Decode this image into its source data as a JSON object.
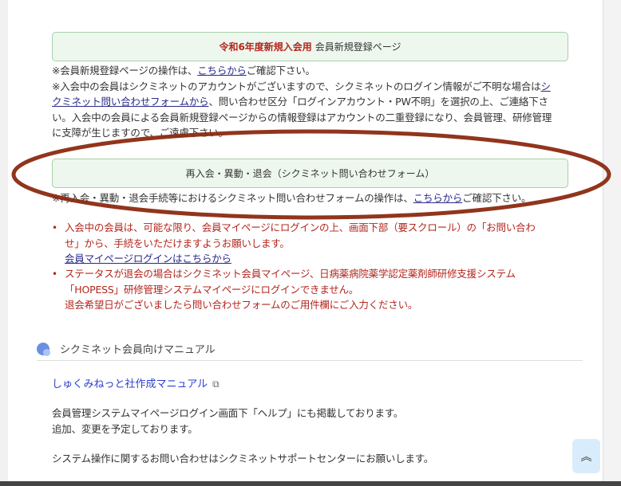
{
  "register_box": {
    "highlight": "令和6年度新規入会用",
    "label": "会員新規登録ページ"
  },
  "register_notes": {
    "l1_pre": "※会員新規登録ページの操作は、",
    "l1_link": "こちらから",
    "l1_post": "ご確認下さい。",
    "l2_pre": "※入会中の会員はシクミネットのアカウントがございますので、シクミネットのログイン情報がご不明な場合は",
    "l2_link": "シ",
    "l3_link": "クミネット問い合わせフォームから",
    "l3_post": "、問い合わせ区分「ログインアカウント・PW不明」を選択の上、ご連絡下さ",
    "l4": "い。入会中の会員による会員新規登録ページからの情報登録はアカウントの二重登録になり、会員管理、研修管理",
    "l5": "に支障が生じますので、ご遠慮下さい。"
  },
  "contact_box": {
    "label": "再入会・異動・退会（シクミネット問い合わせフォーム）"
  },
  "contact_note": {
    "pre": "※再入会・異動・退会手続等におけるシクミネット問い合わせフォームの操作は、",
    "link": "こちらから",
    "post": "ご確認下さい。"
  },
  "bullets": {
    "b1_l1": "入会中の会員は、可能な限り、会員マイページにログインの上、画面下部（要スクロール）の「お問い合わ",
    "b1_l2": "せ」から、手続をいただけますようお願いします。",
    "b1_link": "会員マイページログインはこちらから",
    "b2_l1": "ステータスが退会の場合はシクミネット会員マイページ、日病薬病院薬学認定薬剤師研修支援システム",
    "b2_l2": "「HOPESS」研修管理システムマイページにログインできません。",
    "b2_l3": "退会希望日がございましたら問い合わせフォームのご用件欄にご入力ください。"
  },
  "manual": {
    "heading": "シクミネット会員向けマニュアル",
    "link": "しゅくみねっと社作成マニュアル",
    "p1": "会員管理システムマイページログイン画面下「ヘルプ」にも掲載しております。",
    "p2": "追加、変更を予定しております。",
    "p3": "システム操作に関するお問い合わせはシクミネットサポートセンターにお願いします。"
  },
  "icons": {
    "external": "external-link-icon",
    "scroll_top": "double-chevron-up-icon",
    "bullet": "•",
    "ext_glyph": "⧉",
    "top_glyph": "︽"
  },
  "colors": {
    "highlight_ellipse": "#8b2a10",
    "notice_red": "#b3261e",
    "link_blue": "#2b3fcf"
  }
}
